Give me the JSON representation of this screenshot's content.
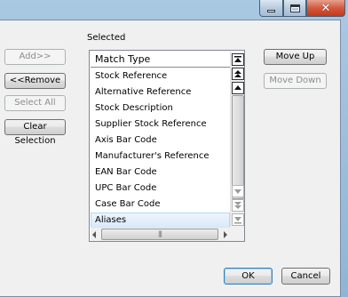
{
  "window": {
    "close_glyph": "✕"
  },
  "left_buttons": {
    "add": "Add>>",
    "remove": "<<Remove",
    "select_all": "Select All",
    "clear_selection": "Clear Selection"
  },
  "selected_group": {
    "label": "Selected",
    "header": "Match Type",
    "rows": [
      "Stock Reference",
      "Alternative Reference",
      "Stock Description",
      "Supplier Stock Reference",
      "Axis Bar Code",
      "Manufacturer's Reference",
      "EAN Bar Code",
      "UPC Bar Code",
      "Case Bar Code",
      "Aliases"
    ],
    "selected_row": "Aliases",
    "hscroll_grip": "|||"
  },
  "right_buttons": {
    "move_up": "Move Up",
    "move_down": "Move Down"
  },
  "footer": {
    "ok": "OK",
    "cancel": "Cancel"
  },
  "icons": {
    "scroll_top": "arrow-top-icon",
    "scroll_page_up": "double-arrow-up-icon",
    "scroll_up": "arrow-up-icon",
    "scroll_down": "arrow-down-icon",
    "scroll_page_down": "double-arrow-down-icon",
    "scroll_bottom": "arrow-bottom-icon"
  },
  "colors": {
    "frame": "#8fb5d6",
    "close_button": "#c2381c",
    "selection": "#d8e9fb"
  }
}
